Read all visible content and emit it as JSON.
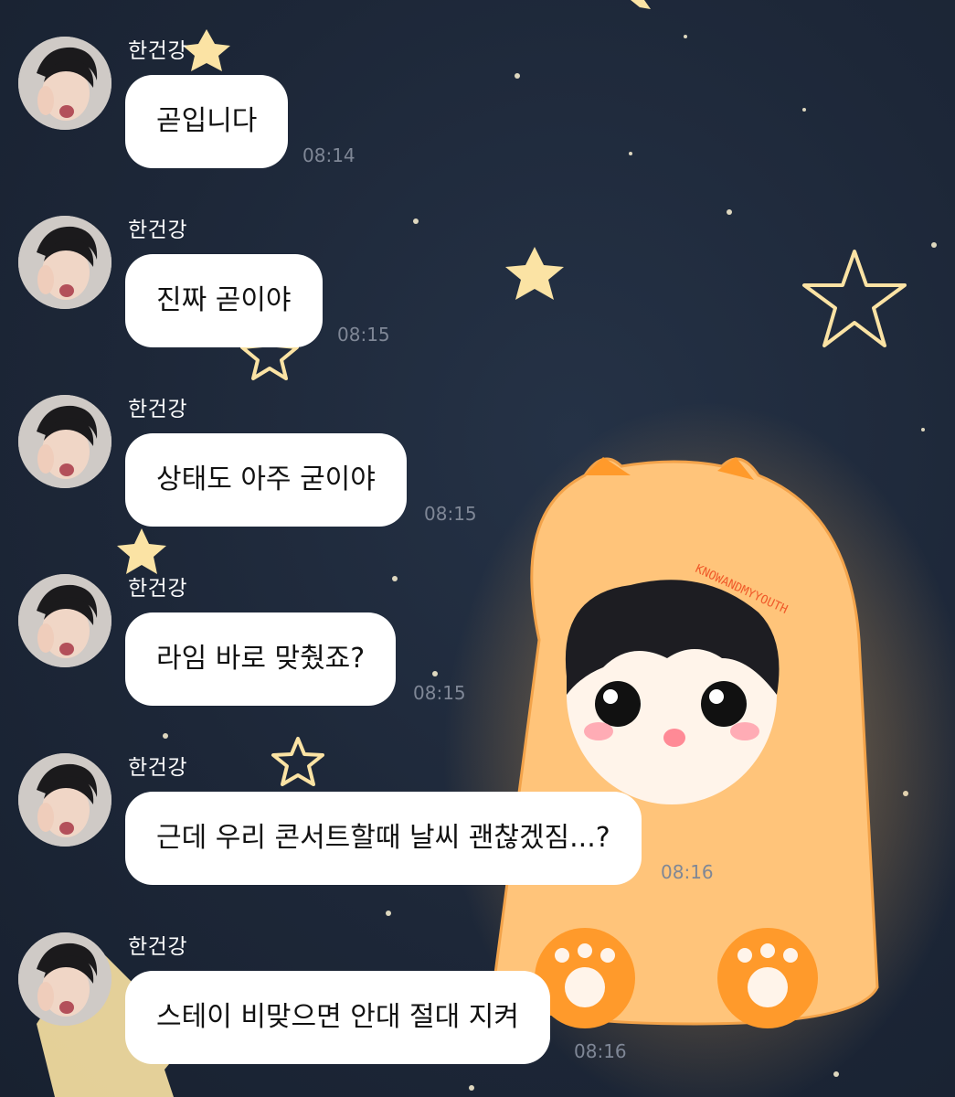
{
  "chat": {
    "messages": [
      {
        "sender": "한건강",
        "text": "곧입니다",
        "time": "08:14"
      },
      {
        "sender": "한건강",
        "text": "진짜 곧이야",
        "time": "08:15"
      },
      {
        "sender": "한건강",
        "text": "상태도 아주 굳이야",
        "time": "08:15"
      },
      {
        "sender": "한건강",
        "text": "라임 바로 맞췄죠?",
        "time": "08:15"
      },
      {
        "sender": "한건강",
        "text": "근데 우리 콘서트할때 날씨 괜찮겠짐...?",
        "time": "08:16"
      },
      {
        "sender": "한건강",
        "text": "스테이 비맞으면 안대 절대 지켜",
        "time": "08:16"
      }
    ]
  },
  "wallpaper": {
    "caption": "KNOWANDMYYOUTH",
    "star_color": "#fbe3a4",
    "hood_color": "#ffc47a",
    "paw_color": "#ff9a2b"
  },
  "colors": {
    "background": "#1f2a3a",
    "bubble": "#ffffff",
    "sender_name": "#ffffff",
    "timestamp": "#7f8796"
  }
}
